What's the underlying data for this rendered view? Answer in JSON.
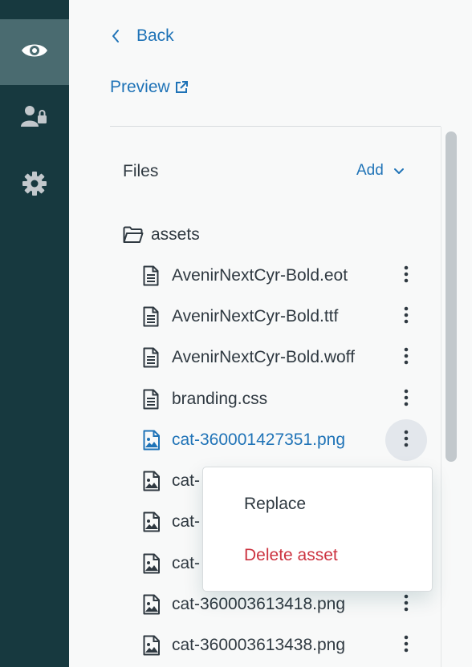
{
  "rail": {
    "items": [
      {
        "icon": "eye-icon",
        "active": true
      },
      {
        "icon": "user-lock-icon",
        "active": false
      },
      {
        "icon": "gear-icon",
        "active": false
      }
    ]
  },
  "nav": {
    "back_label": "Back",
    "preview_label": "Preview"
  },
  "files": {
    "title": "Files",
    "add_label": "Add",
    "folder_name": "assets",
    "items": [
      {
        "name": "AvenirNextCyr-Bold.eot",
        "type": "document"
      },
      {
        "name": "AvenirNextCyr-Bold.ttf",
        "type": "document"
      },
      {
        "name": "AvenirNextCyr-Bold.woff",
        "type": "document"
      },
      {
        "name": "branding.css",
        "type": "document"
      },
      {
        "name": "cat-360001427351.png",
        "type": "image",
        "selected": true
      },
      {
        "name": "cat-",
        "type": "image"
      },
      {
        "name": "cat-",
        "type": "image"
      },
      {
        "name": "cat-",
        "type": "image"
      },
      {
        "name": "cat-360003613418.png",
        "type": "image"
      },
      {
        "name": "cat-360003613438.png",
        "type": "image"
      }
    ]
  },
  "context_menu": {
    "replace_label": "Replace",
    "delete_label": "Delete asset"
  },
  "colors": {
    "rail_bg": "#17393f",
    "link": "#1f73b7",
    "danger": "#cc3340",
    "text": "#2f3941"
  }
}
